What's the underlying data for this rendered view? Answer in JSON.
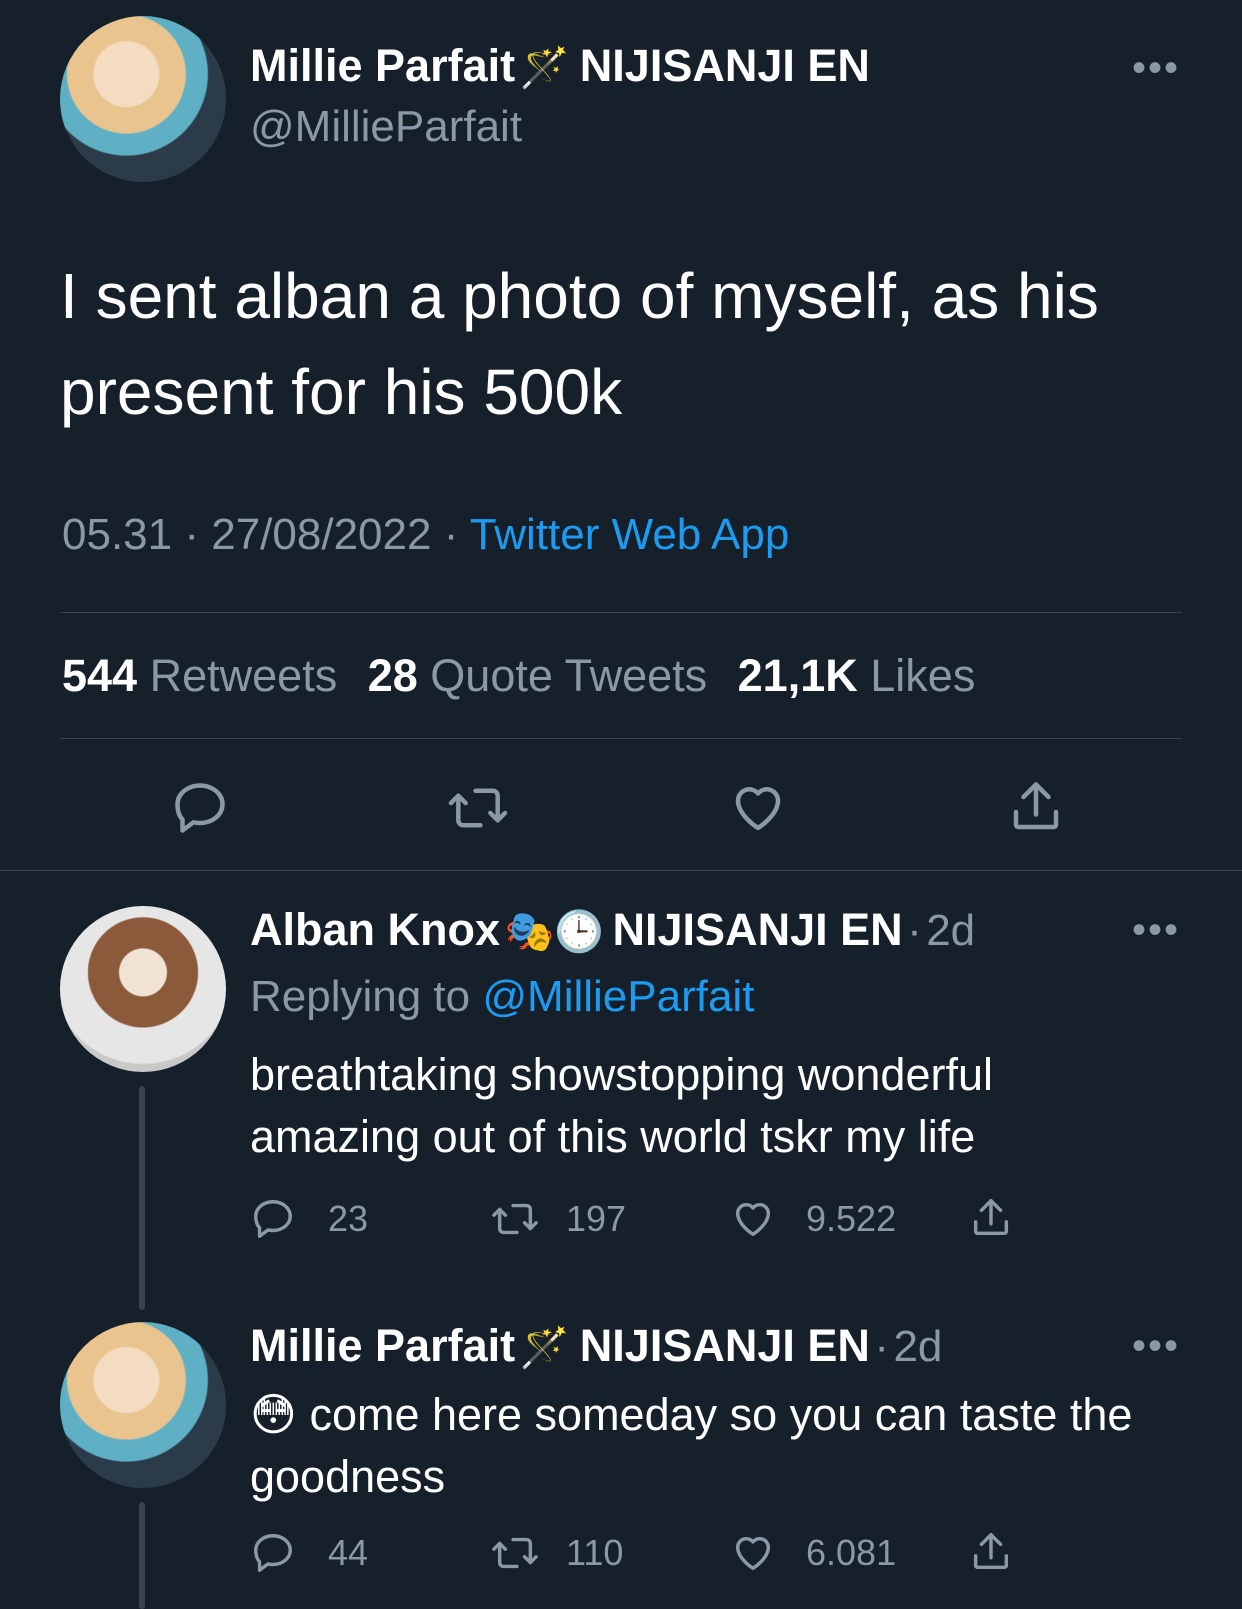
{
  "main_tweet": {
    "author_name": "Millie Parfait",
    "author_emoji": "🪄",
    "affiliation": "NIJISANJI EN",
    "handle": "@MillieParfait",
    "more": "•••",
    "text": "I sent alban a photo of myself, as his present for his 500k",
    "time": "05.31",
    "sep1": "·",
    "date": "27/08/2022",
    "sep2": "·",
    "source": "Twitter Web App",
    "stats": {
      "retweets_count": "544",
      "retweets_label": "Retweets",
      "quotes_count": "28",
      "quotes_label": "Quote Tweets",
      "likes_count": "21,1K",
      "likes_label": "Likes"
    },
    "actions": [
      "reply-icon",
      "retweet-icon",
      "like-icon",
      "share-icon"
    ]
  },
  "replies": [
    {
      "author_name": "Alban Knox",
      "author_emoji": "🎭🕒",
      "affiliation": "NIJISANJI EN",
      "time_sep": "·",
      "time": "2d",
      "more": "•••",
      "replying_prefix": "Replying to",
      "replying_handle": "@MillieParfait",
      "text": "breathtaking showstopping wonderful amazing out of this world tskr my life",
      "reply_count": "23",
      "retweet_count": "197",
      "like_count": "9.522"
    },
    {
      "author_name": "Millie Parfait",
      "author_emoji": "🪄",
      "affiliation": "NIJISANJI EN",
      "time_sep": "·",
      "time": "2d",
      "more": "•••",
      "text_emoji": "😳",
      "text": "come here someday so you can taste the goodness",
      "reply_count": "44",
      "retweet_count": "110",
      "like_count": "6.081"
    }
  ],
  "colors": {
    "background": "#15202b",
    "muted": "#8b98a5",
    "link": "#1d9bf0",
    "divider": "#38444d"
  }
}
